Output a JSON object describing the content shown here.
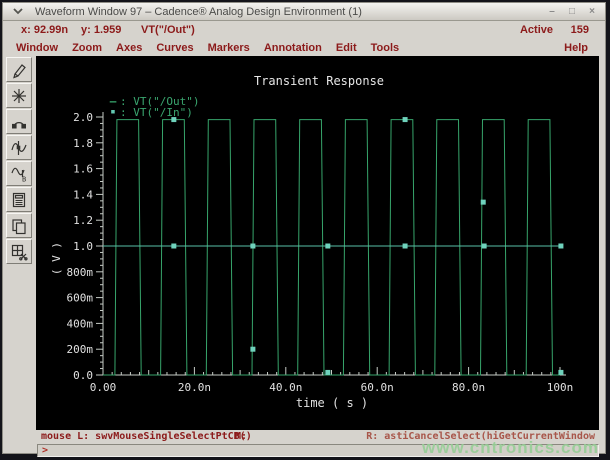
{
  "window": {
    "title": "Waveform Window 97 – Cadence® Analog Design Environment (1)",
    "controls": {
      "minimize": "–",
      "maximize": "□",
      "close": "×"
    }
  },
  "info_bar": {
    "x_value": "x: 92.99n",
    "y_value": "y: 1.959",
    "trace": "VT(\"/Out\")",
    "active_label": "Active",
    "active_count": "159"
  },
  "menu_bar": {
    "items": [
      "Window",
      "Zoom",
      "Axes",
      "Curves",
      "Markers",
      "Annotation",
      "Edit",
      "Tools"
    ],
    "help": "Help"
  },
  "toolbar": {
    "items": [
      {
        "name": "probe-pen-icon"
      },
      {
        "name": "zoom-star-icon"
      },
      {
        "name": "pan-arc-icon"
      },
      {
        "name": "marker-waveform-icon"
      },
      {
        "name": "waveform-b-icon"
      },
      {
        "name": "calculator-icon"
      },
      {
        "name": "copy-window-icon"
      },
      {
        "name": "cut-window-icon"
      }
    ]
  },
  "status_bar": {
    "mouse_left": "mouse L: swvMouseSingleSelectPtCB()",
    "mouse_middle": "M:",
    "mouse_right": "R: astiCancelSelect(hiGetCurrentWindow",
    "prompt": ">"
  },
  "watermark": "www.cntronics.com",
  "colors": {
    "out_trace": "#37a56b",
    "in_trace": "#58bfa8",
    "in_marker": "#6fd2bc",
    "axis": "#c6ccc6",
    "axis_text": "#e0e0e0",
    "menu_text": "#8c1a1a",
    "canvas_bg": "#000000",
    "chrome_bg": "#d6d3cd",
    "watermark_green": "#96cd96"
  },
  "chart_data": {
    "type": "line",
    "title": "Transient Response",
    "xlabel": "time ( s )",
    "ylabel": "( V )",
    "x_unit": "ns",
    "xlim": [
      0,
      100
    ],
    "ylim": [
      0,
      2.0
    ],
    "x_major_ticks": [
      {
        "t": 0,
        "label": "0.00"
      },
      {
        "t": 20,
        "label": "20.0n"
      },
      {
        "t": 40,
        "label": "40.0n"
      },
      {
        "t": 60,
        "label": "60.0n"
      },
      {
        "t": 80,
        "label": "80.0n"
      },
      {
        "t": 100,
        "label": "100n"
      }
    ],
    "y_major_ticks": [
      {
        "v": 0.0,
        "label": "0.0"
      },
      {
        "v": 0.2,
        "label": "200m"
      },
      {
        "v": 0.4,
        "label": "400m"
      },
      {
        "v": 0.6,
        "label": "600m"
      },
      {
        "v": 0.8,
        "label": "800m"
      },
      {
        "v": 1.0,
        "label": "1.0"
      },
      {
        "v": 1.2,
        "label": "1.2"
      },
      {
        "v": 1.4,
        "label": "1.4"
      },
      {
        "v": 1.6,
        "label": "1.6"
      },
      {
        "v": 1.8,
        "label": "1.8"
      },
      {
        "v": 2.0,
        "label": "2.0"
      }
    ],
    "x_minor_step": 2,
    "y_minor_step": 0.05,
    "legend": [
      {
        "glyph": "–",
        "sep": ":",
        "label": "VT(\"/Out\")",
        "color": "#37a56b"
      },
      {
        "glyph": "▪",
        "sep": ":",
        "label": "VT(\"/In\")",
        "color": "#58bfa8"
      }
    ],
    "series": [
      {
        "name": "VT(\"/Out\")",
        "color": "#37a56b",
        "waveform": "pulse_train",
        "pulse": {
          "n_pulses": 10,
          "period": 10,
          "rise_start": 2.6,
          "rise_time": 0.45,
          "high_end": 7.8,
          "fall_time": 0.55,
          "v_low": 0.0,
          "v_high": 1.98,
          "t_start": 0,
          "t_end": 100
        }
      },
      {
        "name": "VT(\"/In\")",
        "color": "#58bfa8",
        "waveform": "flat_line",
        "v": 1.0,
        "t_start": 0,
        "t_end": 100.3,
        "markers_on_line_t": [
          15.5,
          32.8,
          49.2,
          66.1,
          83.4,
          100.2
        ],
        "extra_markers": [
          {
            "t": 15.5,
            "v": 1.98
          },
          {
            "t": 32.8,
            "v": 0.2
          },
          {
            "t": 49.2,
            "v": 0.02
          },
          {
            "t": 66.1,
            "v": 1.98
          },
          {
            "t": 83.2,
            "v": 1.34
          },
          {
            "t": 100.2,
            "v": 0.02
          }
        ]
      }
    ]
  }
}
